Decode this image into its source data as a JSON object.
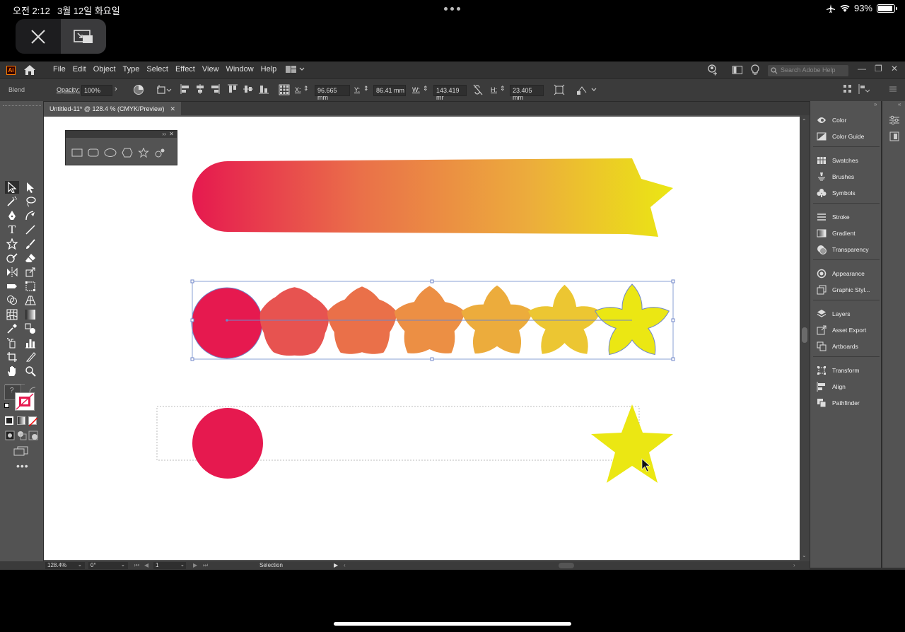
{
  "status_bar": {
    "time": "오전 2:12",
    "date": "3월 12일 화요일",
    "battery": "93%",
    "battery_level": 0.93
  },
  "app": {
    "logo": "Ai",
    "menus": [
      "File",
      "Edit",
      "Object",
      "Type",
      "Select",
      "Effect",
      "View",
      "Window",
      "Help"
    ],
    "search_placeholder": "Search Adobe Help"
  },
  "control_bar": {
    "object_type": "Blend",
    "opacity_label": "Opacity:",
    "opacity_value": "100%",
    "x_label": "X:",
    "x_value": "96.665 mm",
    "y_label": "Y:",
    "y_value": "86.41 mm",
    "w_label": "W:",
    "w_value": "143.419 mr",
    "h_label": "H:",
    "h_value": "23.405 mm"
  },
  "document": {
    "tab_title": "Untitled-11* @ 128.4 % (CMYK/Preview)",
    "close": "✕"
  },
  "artwork": {
    "start_color": "#e6194f",
    "end_color": "#ebe713",
    "blend_steps": [
      "#e6194f",
      "#e75350",
      "#ea7049",
      "#ec8f44",
      "#ecac3c",
      "#ecc632",
      "#ebe713"
    ]
  },
  "right_panels": [
    {
      "label": "Color",
      "icon": "color-icon"
    },
    {
      "label": "Color Guide",
      "icon": "color-guide-icon"
    },
    {
      "label": "Swatches",
      "icon": "swatches-icon"
    },
    {
      "label": "Brushes",
      "icon": "brushes-icon"
    },
    {
      "label": "Symbols",
      "icon": "symbols-icon"
    },
    {
      "label": "Stroke",
      "icon": "stroke-icon"
    },
    {
      "label": "Gradient",
      "icon": "gradient-icon"
    },
    {
      "label": "Transparency",
      "icon": "transparency-icon"
    },
    {
      "label": "Appearance",
      "icon": "appearance-icon"
    },
    {
      "label": "Graphic Styl...",
      "icon": "graphic-styles-icon"
    },
    {
      "label": "Layers",
      "icon": "layers-icon"
    },
    {
      "label": "Asset Export",
      "icon": "asset-export-icon"
    },
    {
      "label": "Artboards",
      "icon": "artboards-icon"
    },
    {
      "label": "Transform",
      "icon": "transform-icon"
    },
    {
      "label": "Align",
      "icon": "align-icon"
    },
    {
      "label": "Pathfinder",
      "icon": "pathfinder-icon"
    }
  ],
  "status": {
    "zoom": "128.4%",
    "rotation": "0°",
    "artboard_number": "1",
    "tool": "Selection"
  }
}
